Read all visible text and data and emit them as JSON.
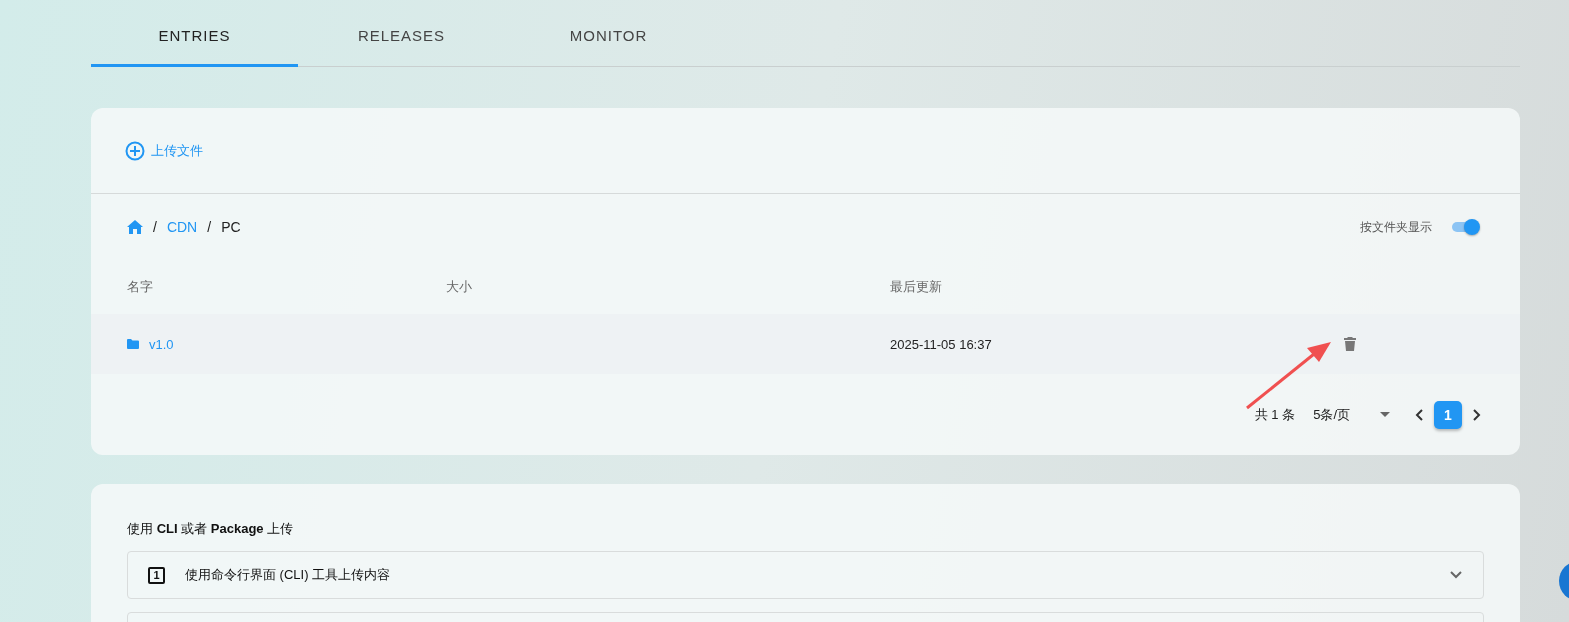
{
  "tabs": [
    {
      "label": "ENTRIES",
      "selected": true
    },
    {
      "label": "RELEASES",
      "selected": false
    },
    {
      "label": "MONITOR",
      "selected": false
    }
  ],
  "upload_button": {
    "label": "上传文件"
  },
  "breadcrumb": [
    {
      "separator": "/",
      "label": "CDN"
    },
    {
      "separator": "/",
      "label": "PC"
    }
  ],
  "folder_toggle": {
    "label": "按文件夹显示",
    "on": true
  },
  "table": {
    "columns": [
      "名字",
      "大小",
      "最后更新"
    ],
    "rows": [
      {
        "name": "v1.0",
        "updated": "2025-11-05 16:37",
        "kind": "folder"
      }
    ]
  },
  "pagination": {
    "total": "共 1 条",
    "page_size": "5条/页",
    "pages": [
      {
        "label": "1",
        "selected": true
      }
    ]
  },
  "cli_section": {
    "title": "使用 **CLI** 或者 **Package** 上传",
    "steps": [
      {
        "marker": "1",
        "label": "使用命令行界面 (CLI) 工具上传内容",
        "expanded": false
      }
    ]
  }
}
